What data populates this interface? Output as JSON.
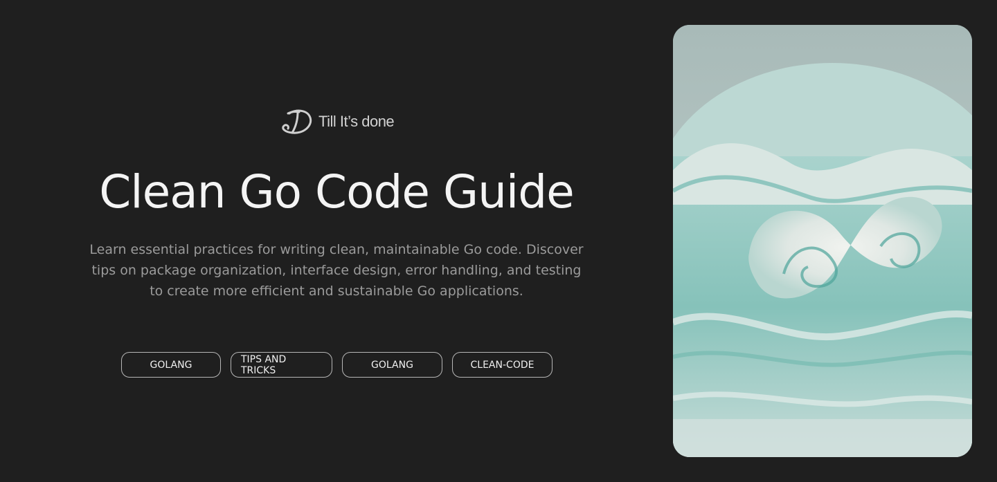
{
  "brand": {
    "name": "Till It’s done",
    "logo_icon": "brand-logo-icon"
  },
  "hero": {
    "title": "Clean Go Code Guide",
    "description": "Learn essential practices for writing clean, maintainable Go code. Discover tips on package organization, interface design, error handling, and testing to create more efficient and sustainable Go applications."
  },
  "tags": [
    {
      "label": "GOLANG"
    },
    {
      "label": "TIPS AND TRICKS"
    },
    {
      "label": "GOLANG"
    },
    {
      "label": "CLEAN-CODE"
    }
  ],
  "colors": {
    "background": "#1f1f1f",
    "title": "#f4f4f4",
    "description": "#9b9b9b",
    "tag_border": "#b8b8b8",
    "accent_teal": "#7fb8b1"
  }
}
